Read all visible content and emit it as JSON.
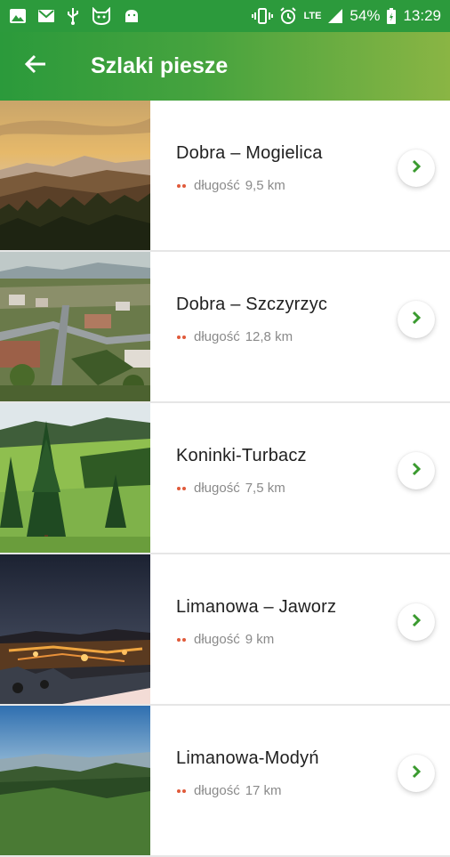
{
  "status_bar": {
    "battery": "54%",
    "time": "13:29",
    "network": "LTE",
    "icons_left": [
      "image-icon",
      "mail-icon",
      "usb-icon",
      "cat-face-icon",
      "android-icon"
    ],
    "icons_right": [
      "vibrate-icon",
      "alarm-icon",
      "lte-icon",
      "signal-icon",
      "battery-charging-icon"
    ]
  },
  "app_bar": {
    "title": "Szlaki piesze",
    "back_icon": "arrow-back-icon"
  },
  "colors": {
    "primary": "#2c9a3c",
    "accent": "#8ab544",
    "arrow": "#3a9a2f",
    "dots": "#e05a3a"
  },
  "trails": [
    {
      "name": "Dobra – Mogielica",
      "length_label": "długość",
      "length": "9,5 km"
    },
    {
      "name": "Dobra – Szczyrzyc",
      "length_label": "długość",
      "length": "12,8 km"
    },
    {
      "name": "Koninki-Turbacz",
      "length_label": "długość",
      "length": "7,5 km"
    },
    {
      "name": "Limanowa – Jaworz",
      "length_label": "długość",
      "length": "9 km"
    },
    {
      "name": "Limanowa-Modyń",
      "length_label": "długość",
      "length": "17 km"
    }
  ]
}
